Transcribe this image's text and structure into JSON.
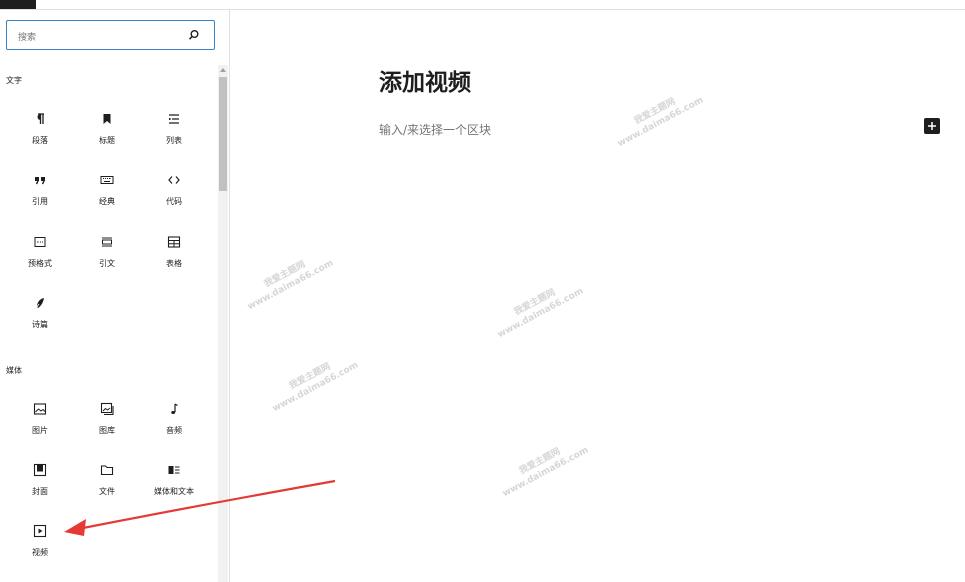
{
  "search": {
    "placeholder": "搜索"
  },
  "categories": {
    "text": "文字",
    "media": "媒体"
  },
  "blocks": {
    "paragraph": "段落",
    "heading": "标题",
    "list": "列表",
    "quote": "引用",
    "classic": "经典",
    "code": "代码",
    "preformatted": "预格式",
    "pullquote": "引文",
    "table": "表格",
    "verse": "诗篇",
    "image": "图片",
    "gallery": "图库",
    "audio": "音频",
    "cover": "封面",
    "file": "文件",
    "media_text": "媒体和文本",
    "video": "视频"
  },
  "editor": {
    "title": "添加视频",
    "placeholder": "输入/来选择一个区块"
  },
  "watermark": {
    "line1": "我爱主题网",
    "line2": "www.daima66.com"
  },
  "colors": {
    "accent": "#3582c4",
    "arrow": "#e53935",
    "dark": "#1e1e1e"
  }
}
